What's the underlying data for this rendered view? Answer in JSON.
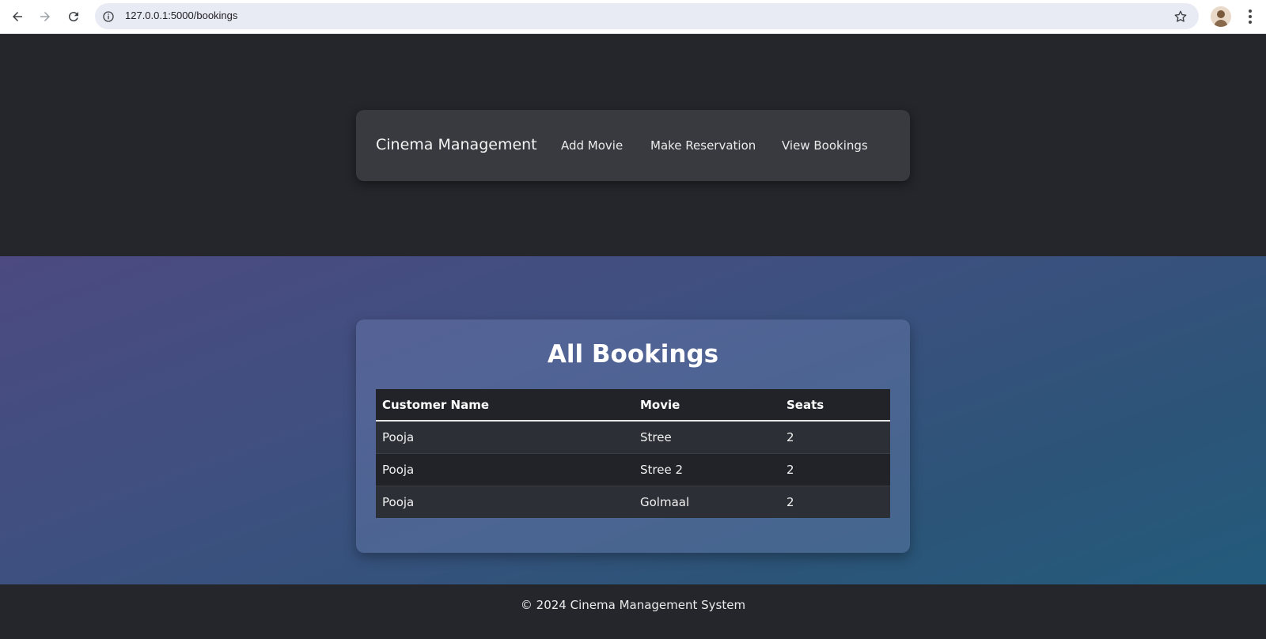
{
  "browser": {
    "url": "127.0.0.1:5000/bookings",
    "back_icon": "arrow-left-icon",
    "forward_icon": "arrow-right-icon",
    "reload_icon": "reload-icon",
    "info_icon": "info-icon",
    "star_icon": "star-icon",
    "menu_icon": "more-vertical-icon"
  },
  "navbar": {
    "brand": "Cinema Management",
    "links": [
      "Add Movie",
      "Make Reservation",
      "View Bookings"
    ]
  },
  "bookings": {
    "title": "All Bookings",
    "columns": [
      "Customer Name",
      "Movie",
      "Seats"
    ],
    "rows": [
      [
        "Pooja",
        "Stree",
        "2"
      ],
      [
        "Pooja",
        "Stree 2",
        "2"
      ],
      [
        "Pooja",
        "Golmaal",
        "2"
      ]
    ]
  },
  "footer": {
    "text": "© 2024 Cinema Management System"
  },
  "colors": {
    "background": "#25262c",
    "navbar": "#393a3f",
    "gradient_start": "#4c4a80",
    "gradient_end": "#235b7c",
    "table_header": "#212328"
  }
}
